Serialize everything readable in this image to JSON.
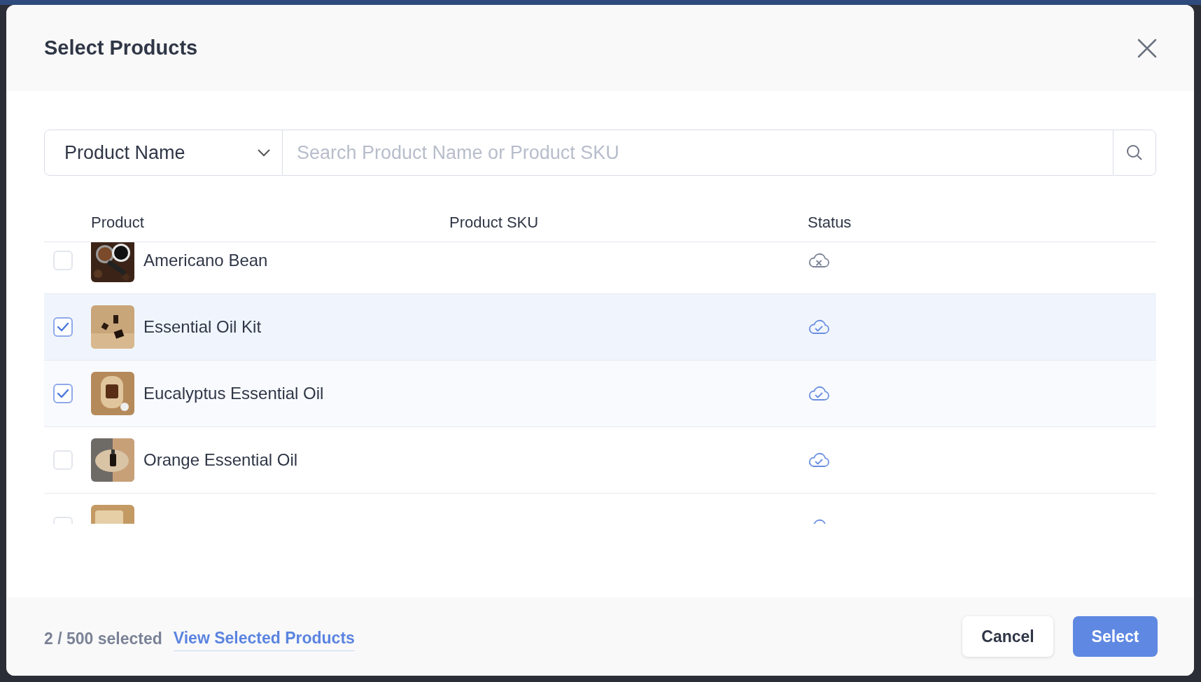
{
  "dialog": {
    "title": "Select Products"
  },
  "filter": {
    "field": "Product Name",
    "placeholder": "Search Product Name or Product SKU"
  },
  "table": {
    "columns": [
      "Product",
      "Product SKU",
      "Status"
    ],
    "rows": [
      {
        "name": "Americano Bean",
        "checked": false,
        "hovered": false,
        "synced": false
      },
      {
        "name": "Essential Oil Kit",
        "checked": true,
        "hovered": true,
        "synced": true
      },
      {
        "name": "Eucalyptus Essential Oil",
        "checked": true,
        "hovered": false,
        "synced": true
      },
      {
        "name": "Orange Essential Oil",
        "checked": false,
        "hovered": false,
        "synced": true
      },
      {
        "checked": false,
        "hovered": false,
        "synced": true
      }
    ]
  },
  "footer": {
    "count": "2 / 500 selected",
    "link": "View Selected Products",
    "buttons": [
      "Cancel",
      "Select"
    ]
  }
}
